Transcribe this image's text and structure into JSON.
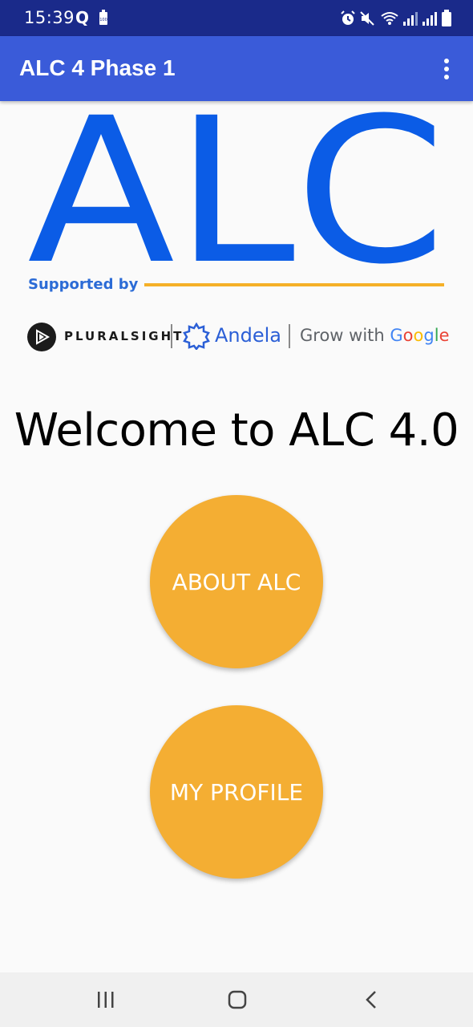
{
  "status_bar": {
    "time": "15:39",
    "notification_letter": "Q",
    "battery_badge": "100",
    "icons": [
      "alarm-icon",
      "mute-icon",
      "wifi-icon",
      "signal-icon",
      "signal-icon",
      "battery-icon"
    ]
  },
  "app_bar": {
    "title": "ALC 4 Phase 1",
    "menu_icon": "overflow-menu-icon"
  },
  "banner": {
    "logo_text": "ALC",
    "supported_by": "Supported by",
    "partners": {
      "pluralsight": "PLURALSIGHT",
      "andela": "Andela",
      "grow_prefix": "Grow with ",
      "google": [
        "G",
        "o",
        "o",
        "g",
        "l",
        "e"
      ]
    }
  },
  "main": {
    "welcome": "Welcome to ALC 4.0",
    "about_button": "ABOUT ALC",
    "profile_button": "MY PROFILE"
  },
  "colors": {
    "status_bar": "#1a2a8a",
    "app_bar": "#3a5bd9",
    "logo_blue": "#0b5ce6",
    "accent_orange": "#f4ae33",
    "background": "#fafafa"
  },
  "nav_bar": {
    "icons": [
      "recent-apps-icon",
      "home-icon",
      "back-icon"
    ]
  }
}
